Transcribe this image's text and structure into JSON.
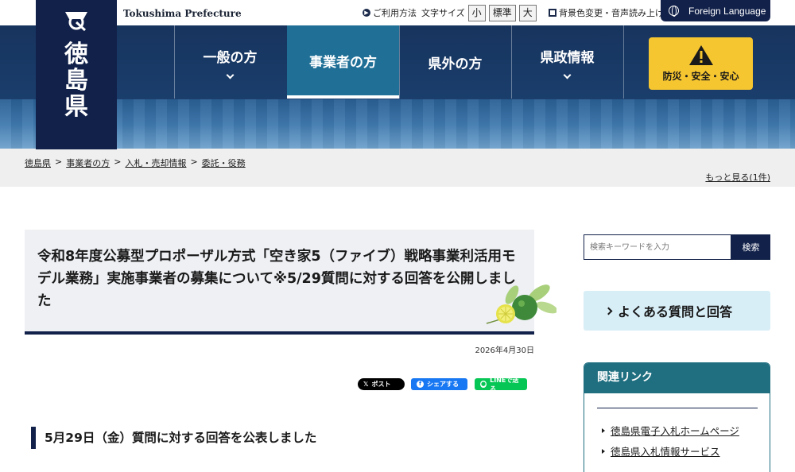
{
  "header": {
    "site_name_en": "Tokushima Prefecture",
    "logo_text": "徳\n島\n県",
    "how_to_use": "ご利用方法",
    "font_size_label": "文字サイズ",
    "font_sizes": [
      "小",
      "標準",
      "大"
    ],
    "bg_color_audio": "背景色変更・音声読み上げ",
    "foreign_language": "Foreign Language",
    "disaster_label": "防災・安全・安心"
  },
  "nav": [
    {
      "label": "一般の方",
      "has_menu": true,
      "active": false
    },
    {
      "label": "事業者の方",
      "has_menu": false,
      "active": true
    },
    {
      "label": "県外の方",
      "has_menu": false,
      "active": false
    },
    {
      "label": "県政情報",
      "has_menu": true,
      "active": false
    }
  ],
  "breadcrumb": {
    "items": [
      "徳島県",
      "事業者の方",
      "入札・売却情報",
      "委託・役務"
    ],
    "separator": ">",
    "more": "もっと見る(1件)"
  },
  "article": {
    "title": "令和8年度公募型プロポーザル方式「空き家5（ファイブ）戦略事業利活用モデル業務」実施事業者の募集について※5/29質問に対する回答を公開しました",
    "date": "2026年4月30日",
    "share_x": "ポスト",
    "share_facebook": "シェアする",
    "share_line": "LINEで送る",
    "section_heading": "5月29日（金）質問に対する回答を公表しました"
  },
  "sidebar": {
    "search_placeholder": "検索キーワードを入力",
    "search_button": "検索",
    "faq": "よくある質問と回答",
    "related_heading": "関連リンク",
    "related_links": [
      "徳島県電子入札ホームページ",
      "徳島県入札情報サービス"
    ]
  },
  "colors": {
    "navy": "#12214a",
    "nav_active": "#1f6f96",
    "disaster_yellow": "#f6c630",
    "related_teal": "#1f6f80",
    "faq_bg": "#d8eef7"
  }
}
